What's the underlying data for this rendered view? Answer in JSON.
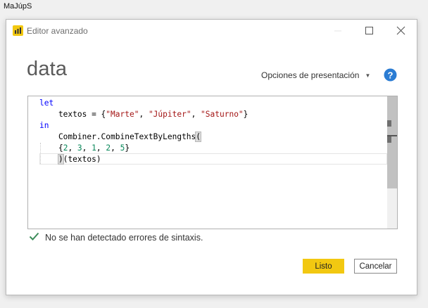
{
  "background_window": {
    "title": "MaJúpS"
  },
  "dialog": {
    "title": "Editor avanzado",
    "query_name": "data",
    "display_options_label": "Opciones de presentación",
    "help_icon": "question-circle-icon",
    "code_lines": [
      [
        {
          "t": "let",
          "c": "kw"
        }
      ],
      [
        {
          "t": "    textos = {",
          "c": ""
        },
        {
          "t": "\"Marte\"",
          "c": "str"
        },
        {
          "t": ", ",
          "c": ""
        },
        {
          "t": "\"Júpiter\"",
          "c": "str"
        },
        {
          "t": ", ",
          "c": ""
        },
        {
          "t": "\"Saturno\"",
          "c": "str"
        },
        {
          "t": "}",
          "c": ""
        }
      ],
      [
        {
          "t": "in",
          "c": "kw"
        }
      ],
      [
        {
          "t": "    Combiner.CombineTextByLengths",
          "c": ""
        },
        {
          "t": "(",
          "c": "bracket-hl"
        }
      ],
      [
        {
          "t": "    {",
          "c": ""
        },
        {
          "t": "2",
          "c": "num"
        },
        {
          "t": ", ",
          "c": ""
        },
        {
          "t": "3",
          "c": "num"
        },
        {
          "t": ", ",
          "c": ""
        },
        {
          "t": "1",
          "c": "num"
        },
        {
          "t": ", ",
          "c": ""
        },
        {
          "t": "2",
          "c": "num"
        },
        {
          "t": ", ",
          "c": ""
        },
        {
          "t": "5",
          "c": "num"
        },
        {
          "t": "}",
          "c": ""
        }
      ],
      [
        {
          "t": "    ",
          "c": ""
        },
        {
          "t": ")",
          "c": "bracket-hl"
        },
        {
          "t": "(textos)",
          "c": ""
        }
      ]
    ],
    "status_message": "No se han detectado errores de sintaxis.",
    "done_label": "Listo",
    "cancel_label": "Cancelar"
  },
  "colors": {
    "accent": "#f2c811",
    "keyword": "#0000ff",
    "string": "#a31515",
    "number": "#09885a",
    "success": "#3c8c5a",
    "help": "#2b7cd3"
  }
}
